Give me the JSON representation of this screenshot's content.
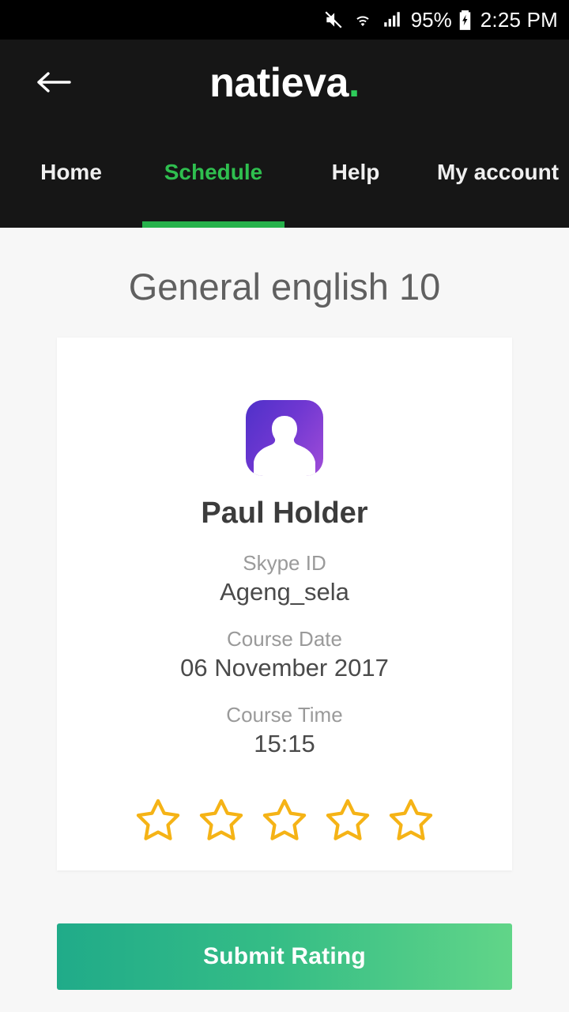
{
  "status_bar": {
    "battery_percent": "95%",
    "time": "2:25 PM",
    "icons": [
      "mute-icon",
      "wifi-icon",
      "signal-icon",
      "battery-charging-icon"
    ]
  },
  "app_bar": {
    "back_icon": "arrow-left-icon",
    "brand_name": "natieva",
    "brand_dot": ".",
    "brand_accent_color": "#2ecc5a"
  },
  "tabs": [
    {
      "label": "Home",
      "active": false
    },
    {
      "label": "Schedule",
      "active": true
    },
    {
      "label": "Help",
      "active": false
    },
    {
      "label": "My account",
      "active": false
    }
  ],
  "page": {
    "title": "General english 10"
  },
  "card": {
    "avatar_icon": "user-avatar-icon",
    "person_name": "Paul Holder",
    "fields": [
      {
        "label": "Skype ID",
        "value": "Ageng_sela"
      },
      {
        "label": "Course Date",
        "value": "06 November 2017"
      },
      {
        "label": "Course Time",
        "value": "15:15"
      }
    ],
    "rating": {
      "max": 5,
      "selected": 0,
      "star_color": "#f5b316"
    }
  },
  "submit_button": {
    "label": "Submit Rating",
    "gradient_from": "#20ab89",
    "gradient_to": "#61d588"
  }
}
